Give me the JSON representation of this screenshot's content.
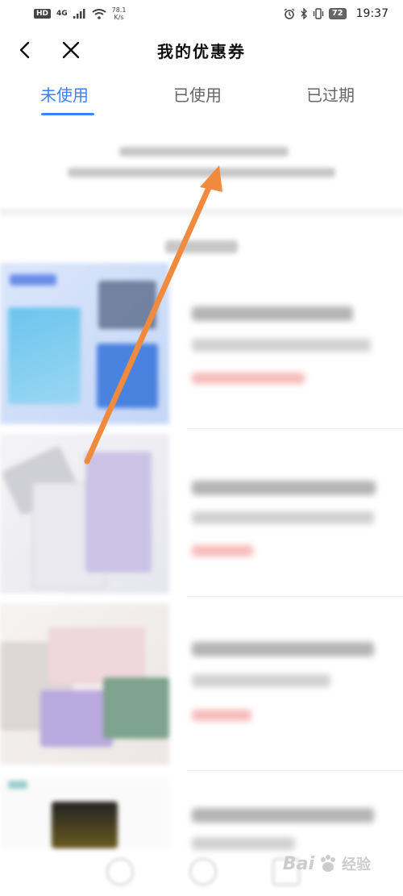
{
  "status_bar": {
    "hd": "HD",
    "network": "4G",
    "speed_value": "78.1",
    "speed_unit": "K/s",
    "battery": "72",
    "time": "19:37"
  },
  "header": {
    "title": "我的优惠券",
    "back_icon": "chevron-left-icon",
    "close_icon": "close-icon"
  },
  "tabs": [
    {
      "label": "未使用",
      "active": true
    },
    {
      "label": "已使用",
      "active": false
    },
    {
      "label": "已过期",
      "active": false
    }
  ],
  "watermark": {
    "text": "Bai",
    "suffix": "经验"
  },
  "colors": {
    "accent": "#3b82f6",
    "arrow": "#f08a3c",
    "price": "#e66666"
  }
}
